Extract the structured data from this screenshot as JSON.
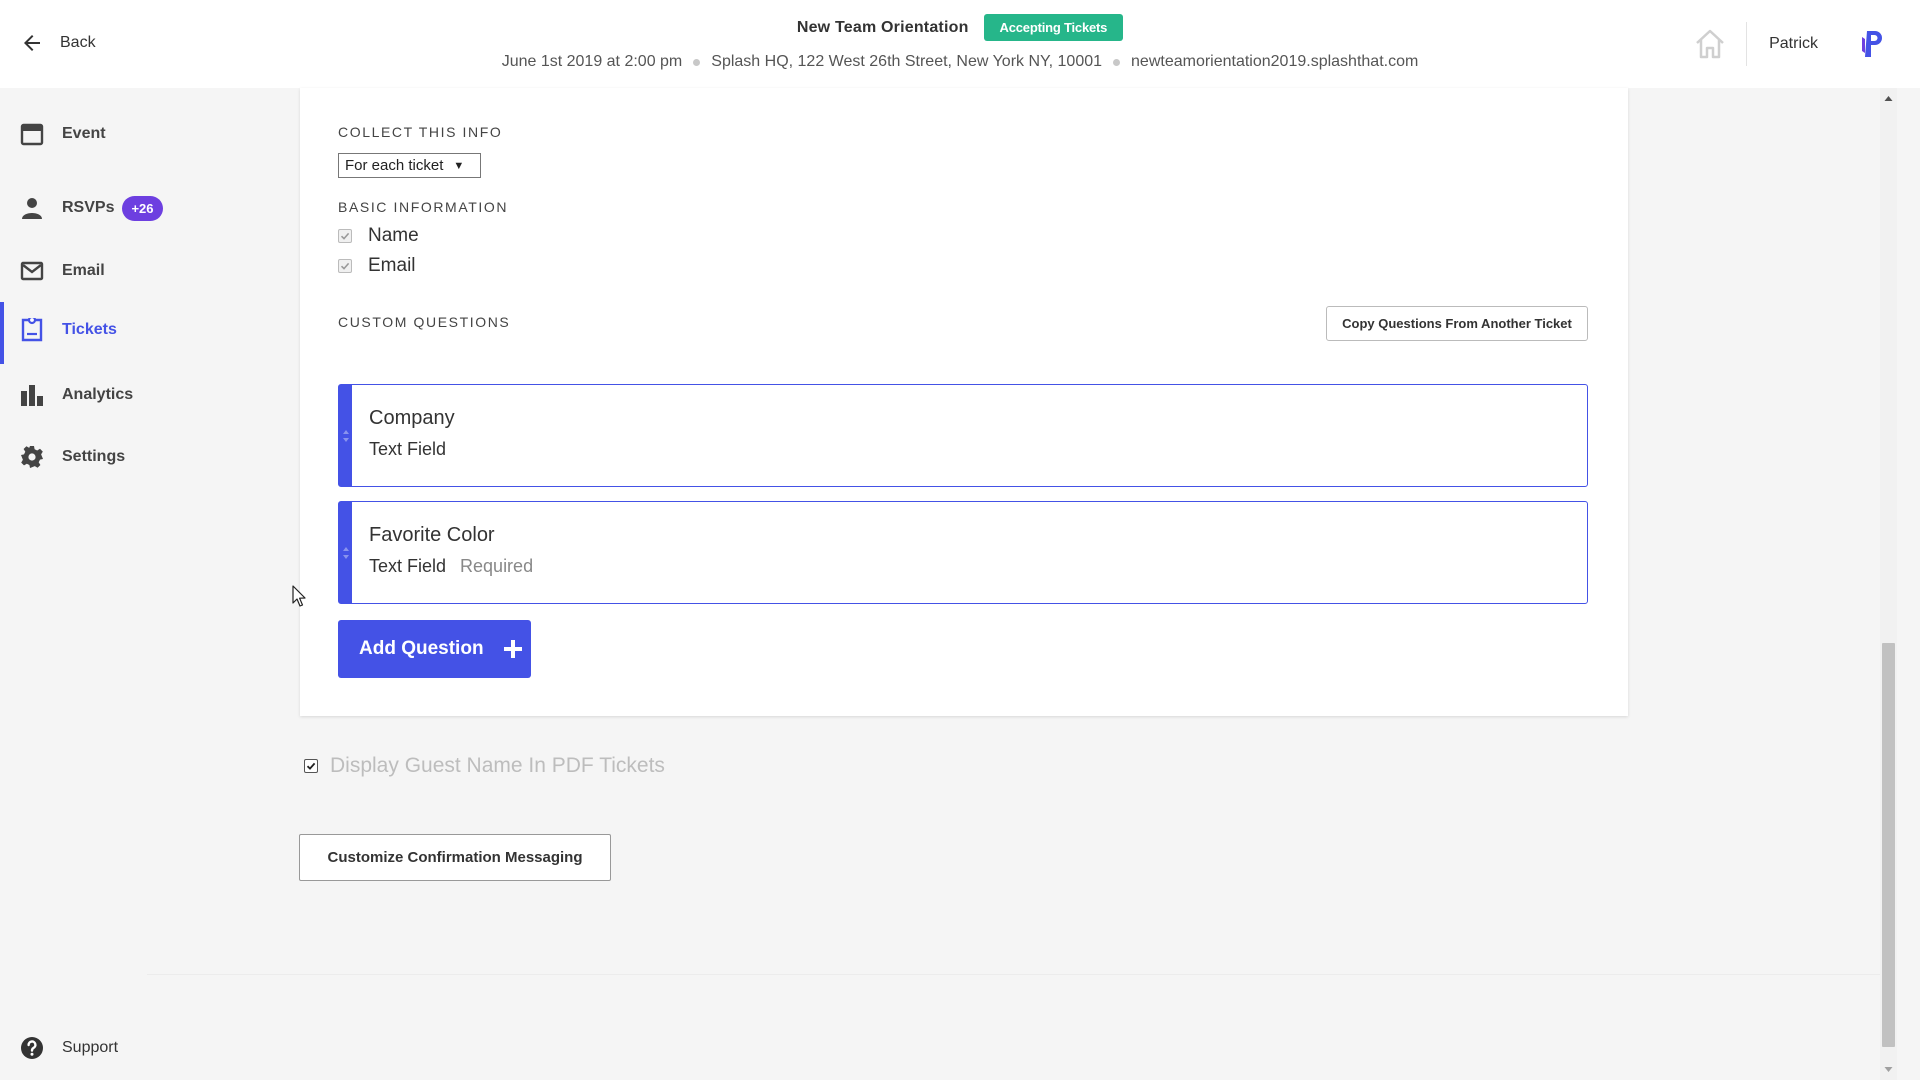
{
  "header": {
    "back_label": "Back",
    "event_title": "New Team Orientation",
    "status_badge": "Accepting Tickets",
    "date": "June 1st 2019 at 2:00 pm",
    "location": "Splash HQ, 122 West 26th Street, New York NY, 10001",
    "url": "newteamorientation2019.splashthat.com",
    "user_name": "Patrick",
    "icons": [
      "back-arrow-icon",
      "home-icon",
      "brand-logo-icon"
    ]
  },
  "sidebar": {
    "items": [
      {
        "label": "Event",
        "icon": "calendar-icon"
      },
      {
        "label": "RSVPs",
        "icon": "person-icon",
        "badge": "+26"
      },
      {
        "label": "Email",
        "icon": "envelope-icon"
      },
      {
        "label": "Tickets",
        "icon": "ticket-icon",
        "active": true
      },
      {
        "label": "Analytics",
        "icon": "bar-chart-icon"
      },
      {
        "label": "Settings",
        "icon": "gear-icon"
      }
    ],
    "support_label": "Support"
  },
  "form": {
    "collect_label": "COLLECT THIS INFO",
    "collect_select_value": "For each ticket",
    "basic_label": "BASIC INFORMATION",
    "basic_fields": [
      {
        "label": "Name",
        "checked": true
      },
      {
        "label": "Email",
        "checked": true
      }
    ],
    "custom_label": "CUSTOM QUESTIONS",
    "copy_button": "Copy Questions From Another Ticket",
    "questions": [
      {
        "title": "Company",
        "type": "Text Field",
        "required": ""
      },
      {
        "title": "Favorite Color",
        "type": "Text Field",
        "required": "Required"
      }
    ],
    "add_question_button": "Add Question",
    "display_guest_name_label": "Display Guest Name In PDF Tickets",
    "display_guest_name_checked": true,
    "customize_button": "Customize Confirmation Messaging"
  },
  "colors": {
    "accent": "#4452e6",
    "badge_purple": "#6d3fe0",
    "status_green": "#26b68a"
  }
}
